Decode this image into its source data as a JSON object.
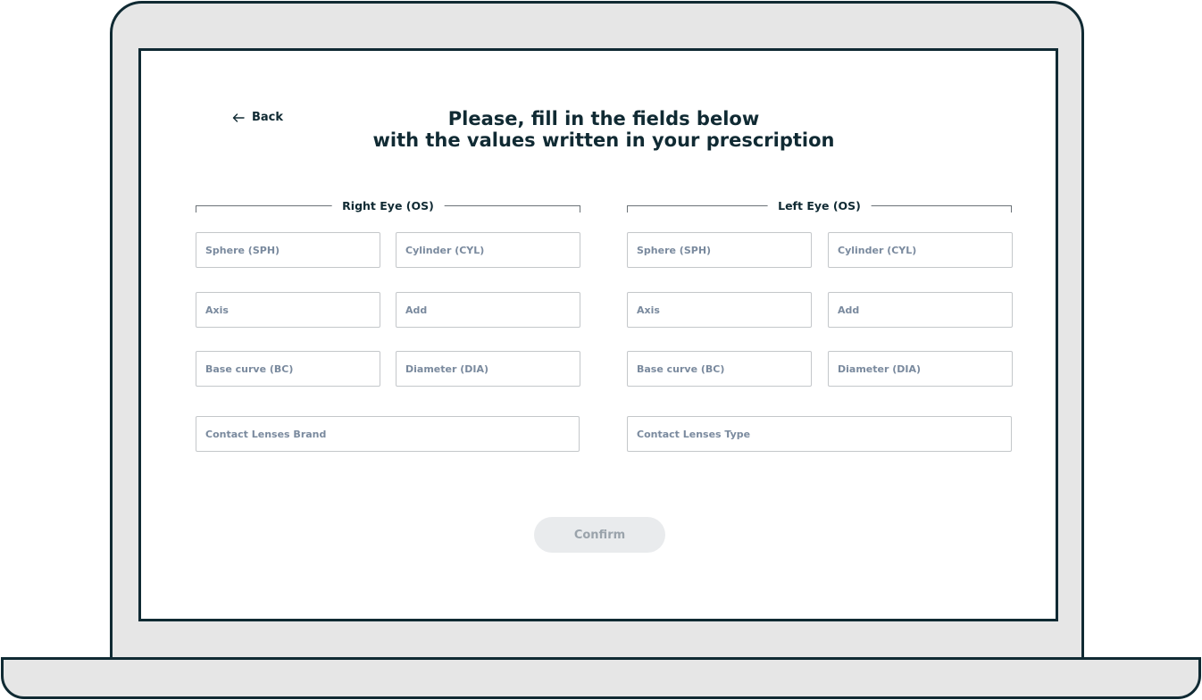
{
  "header": {
    "back_label": "Back",
    "title_line1": "Please, fill in the fields below",
    "title_line2": "with the values written in your prescription"
  },
  "right_eye": {
    "heading": "Right Eye (OS)",
    "sphere_placeholder": "Sphere (SPH)",
    "cylinder_placeholder": "Cylinder (CYL)",
    "axis_placeholder": "Axis",
    "add_placeholder": "Add",
    "base_curve_placeholder": "Base curve (BC)",
    "diameter_placeholder": "Diameter (DIA)",
    "brand_placeholder": "Contact Lenses Brand",
    "sphere_value": "",
    "cylinder_value": "",
    "axis_value": "",
    "add_value": "",
    "base_curve_value": "",
    "diameter_value": "",
    "brand_value": ""
  },
  "left_eye": {
    "heading": "Left Eye (OS)",
    "sphere_placeholder": "Sphere (SPH)",
    "cylinder_placeholder": "Cylinder (CYL)",
    "axis_placeholder": "Axis",
    "add_placeholder": "Add",
    "base_curve_placeholder": "Base curve (BC)",
    "diameter_placeholder": "Diameter (DIA)",
    "type_placeholder": "Contact Lenses Type",
    "sphere_value": "",
    "cylinder_value": "",
    "axis_value": "",
    "add_value": "",
    "base_curve_value": "",
    "diameter_value": "",
    "type_value": ""
  },
  "footer": {
    "confirm_label": "Confirm",
    "confirm_state": "disabled"
  },
  "icons": {
    "back": "arrow-left-icon"
  },
  "colors": {
    "frame_outline": "#102a33",
    "frame_fill": "#e6e6e6",
    "text_primary": "#102a33",
    "placeholder": "#7a8a9e",
    "field_border": "#c4c7ca",
    "button_disabled_bg": "#e9ebed",
    "button_disabled_text": "#9aa3ab"
  }
}
